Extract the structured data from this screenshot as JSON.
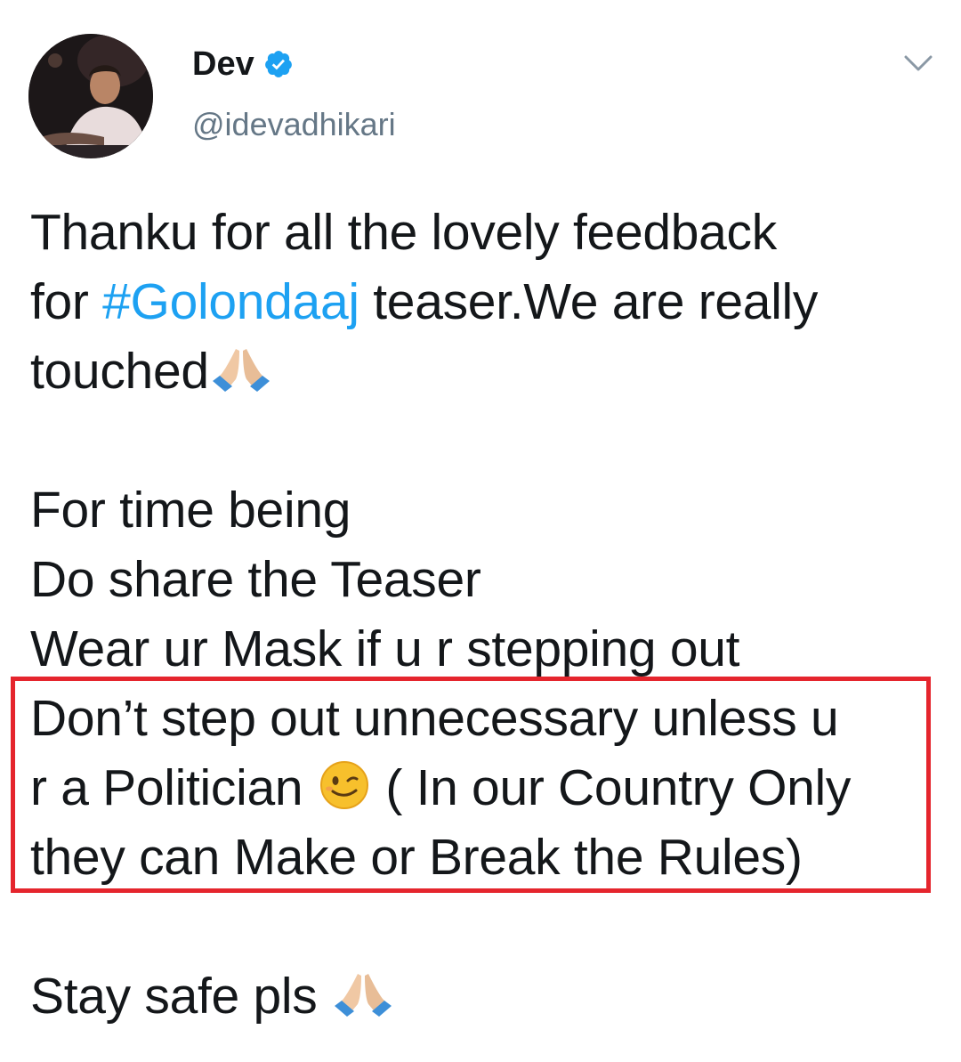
{
  "author": {
    "display_name": "Dev",
    "handle": "@idevadhikari",
    "verified": true,
    "avatar_icon": "profile-photo"
  },
  "menu": {
    "icon": "chevron-down-icon"
  },
  "tweet": {
    "line1": "Thanku for all the lovely feedback",
    "line2_prefix": "for ",
    "hashtag": "#Golondaaj",
    "line2_suffix": " teaser.We are really",
    "line3": "touched",
    "line4": "For time being",
    "line5": "Do share the Teaser",
    "line6": "Wear ur Mask if u r stepping out",
    "line7": "Don’t step out unnecessary unless u",
    "line8_prefix": "r a Politician ",
    "line8_suffix": " ( In our Country Only",
    "line9": "they can Make or Break the Rules)",
    "line10": "Stay safe pls "
  },
  "colors": {
    "hashtag": "#1da1f2",
    "verified": "#1da1f2",
    "highlight_border": "#e5252d",
    "handle": "#657786"
  },
  "emojis": [
    "folded-hands-icon",
    "winking-face-icon",
    "folded-hands-icon"
  ]
}
